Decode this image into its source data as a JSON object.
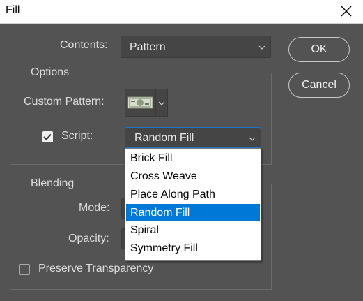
{
  "window": {
    "title": "Fill"
  },
  "buttons": {
    "ok": "OK",
    "cancel": "Cancel"
  },
  "contents": {
    "label": "Contents:",
    "value": "Pattern"
  },
  "options": {
    "legend": "Options",
    "custom_pattern_label": "Custom Pattern:",
    "script_label": "Script:",
    "script_checked": true,
    "script_value": "Random Fill"
  },
  "blending": {
    "legend": "Blending",
    "mode_label": "Mode:",
    "opacity_label": "Opacity:",
    "preserve_label": "Preserve Transparency",
    "preserve_checked": false
  },
  "script_dropdown": {
    "options": [
      "Brick Fill",
      "Cross Weave",
      "Place Along Path",
      "Random Fill",
      "Spiral",
      "Symmetry Fill"
    ],
    "selected_index": 3
  },
  "colors": {
    "background": "#535353",
    "selection": "#0078d7",
    "control": "#454545"
  },
  "icons": {
    "close": "close-icon",
    "chevron": "chevron-down-icon",
    "check": "check-icon",
    "pattern": "dollar-bill-pattern-icon"
  }
}
